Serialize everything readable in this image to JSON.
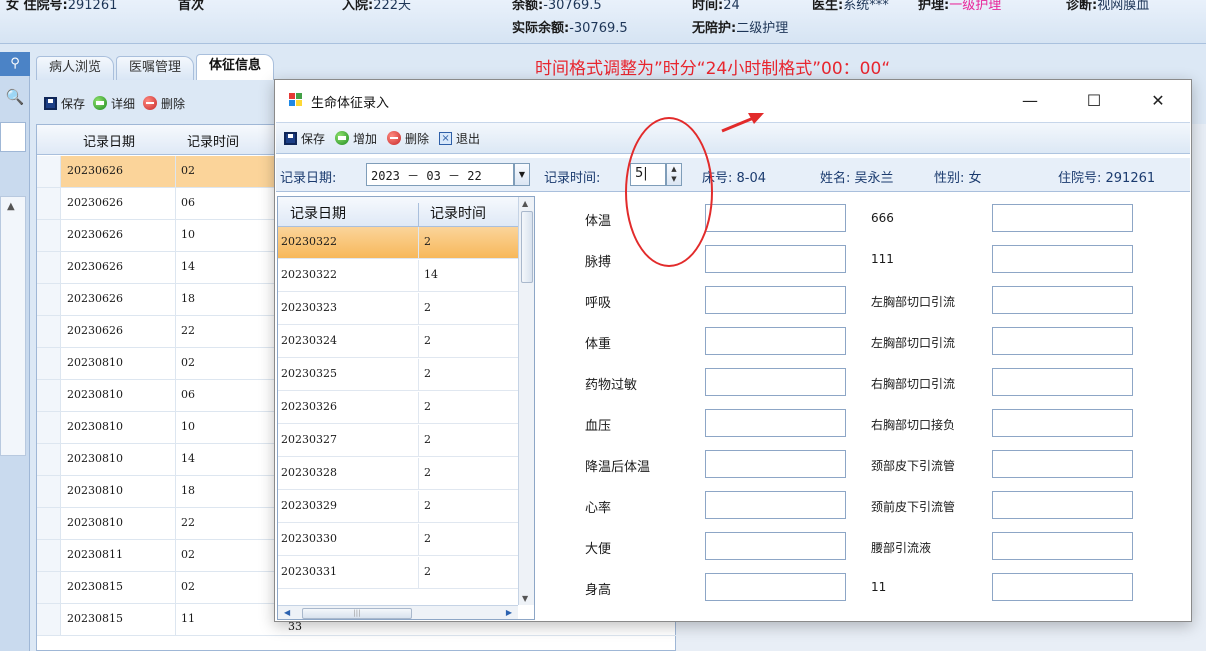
{
  "header": {
    "row1": [
      {
        "label": "女  住院号:",
        "value": "291261"
      },
      {
        "label": "首次",
        "value": ""
      },
      {
        "label": "入院:",
        "value": "222天"
      },
      {
        "label": "余额:",
        "value": "-30769.5"
      },
      {
        "label": "时间:",
        "value": "24"
      },
      {
        "label": "医生:",
        "value": "系统***"
      },
      {
        "label": "护理:",
        "value": "一级护理"
      },
      {
        "label": "诊断:",
        "value": "视网膜血"
      }
    ],
    "row2": [
      {
        "label": "实际余额:",
        "value": "-30769.5"
      },
      {
        "label": "无陪护:",
        "value": "二级护理"
      }
    ]
  },
  "tabs": [
    "病人浏览",
    "医嘱管理",
    "体征信息"
  ],
  "background_toolbar": {
    "save": "保存",
    "detail": "详细",
    "delete": "删除"
  },
  "background_grid": {
    "headers": [
      "记录日期",
      "记录时间"
    ],
    "rows": [
      [
        "20230626",
        "02"
      ],
      [
        "20230626",
        "06"
      ],
      [
        "20230626",
        "10"
      ],
      [
        "20230626",
        "14"
      ],
      [
        "20230626",
        "18"
      ],
      [
        "20230626",
        "22"
      ],
      [
        "20230810",
        "02"
      ],
      [
        "20230810",
        "06"
      ],
      [
        "20230810",
        "10"
      ],
      [
        "20230810",
        "14"
      ],
      [
        "20230810",
        "18"
      ],
      [
        "20230810",
        "22"
      ],
      [
        "20230811",
        "02"
      ],
      [
        "20230815",
        "02"
      ],
      [
        "20230815",
        "11"
      ]
    ],
    "stray_cell": "33"
  },
  "annotation": "时间格式调整为”时分“24小时制格式”00：00“",
  "dialog": {
    "title": "生命体征录入",
    "window_buttons": {
      "minimize": "—",
      "maximize": "☐",
      "close": "✕"
    },
    "toolbar": {
      "save": "保存",
      "add": "增加",
      "delete": "删除",
      "exit": "退出"
    },
    "form": {
      "date_label": "记录日期:",
      "date_value": "2023 － 03 － 22",
      "time_label": "记录时间:",
      "time_value": "5|",
      "bed": "床号: 8-04",
      "name": "姓名: 吴永兰",
      "gender": "性别: 女",
      "admission": "住院号: 291261"
    },
    "grid": {
      "headers": [
        "记录日期",
        "记录时间"
      ],
      "rows": [
        [
          "20230322",
          "2"
        ],
        [
          "20230322",
          "14"
        ],
        [
          "20230323",
          "2"
        ],
        [
          "20230324",
          "2"
        ],
        [
          "20230325",
          "2"
        ],
        [
          "20230326",
          "2"
        ],
        [
          "20230327",
          "2"
        ],
        [
          "20230328",
          "2"
        ],
        [
          "20230329",
          "2"
        ],
        [
          "20230330",
          "2"
        ],
        [
          "20230331",
          "2"
        ]
      ]
    },
    "vitals_left": [
      "体温",
      "脉搏",
      "呼吸",
      "体重",
      "药物过敏",
      "血压",
      "降温后体温",
      "心率",
      "大便",
      "身高"
    ],
    "vitals_right": [
      "666",
      "111",
      "左胸部切口引流",
      "左胸部切口引流",
      "右胸部切口引流",
      "右胸部切口接负",
      "颈部皮下引流管",
      "颈前皮下引流管",
      "腰部引流液",
      "11"
    ]
  },
  "colors": {
    "annotation": "#e8262f",
    "selected_row": "#fbd49a",
    "pink": "#e8279a"
  }
}
